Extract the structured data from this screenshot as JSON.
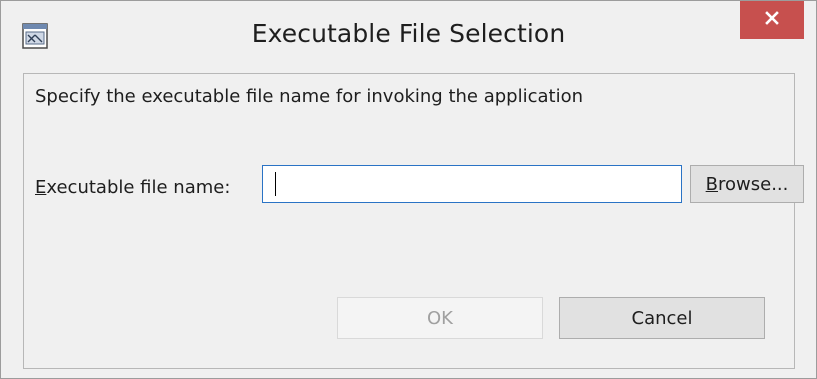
{
  "window": {
    "title": "Executable File Selection",
    "app_icon": "window-app-icon",
    "close_icon": "close-icon",
    "close_color": "#c7504e"
  },
  "dialog": {
    "instruction": "Specify the executable file name for invoking the application",
    "field": {
      "label_mnemonic": "E",
      "label_rest": "xecutable file name:",
      "value": "",
      "placeholder": ""
    },
    "buttons": {
      "browse_mnemonic": "B",
      "browse_rest": "rowse...",
      "ok": "OK",
      "cancel": "Cancel"
    }
  }
}
